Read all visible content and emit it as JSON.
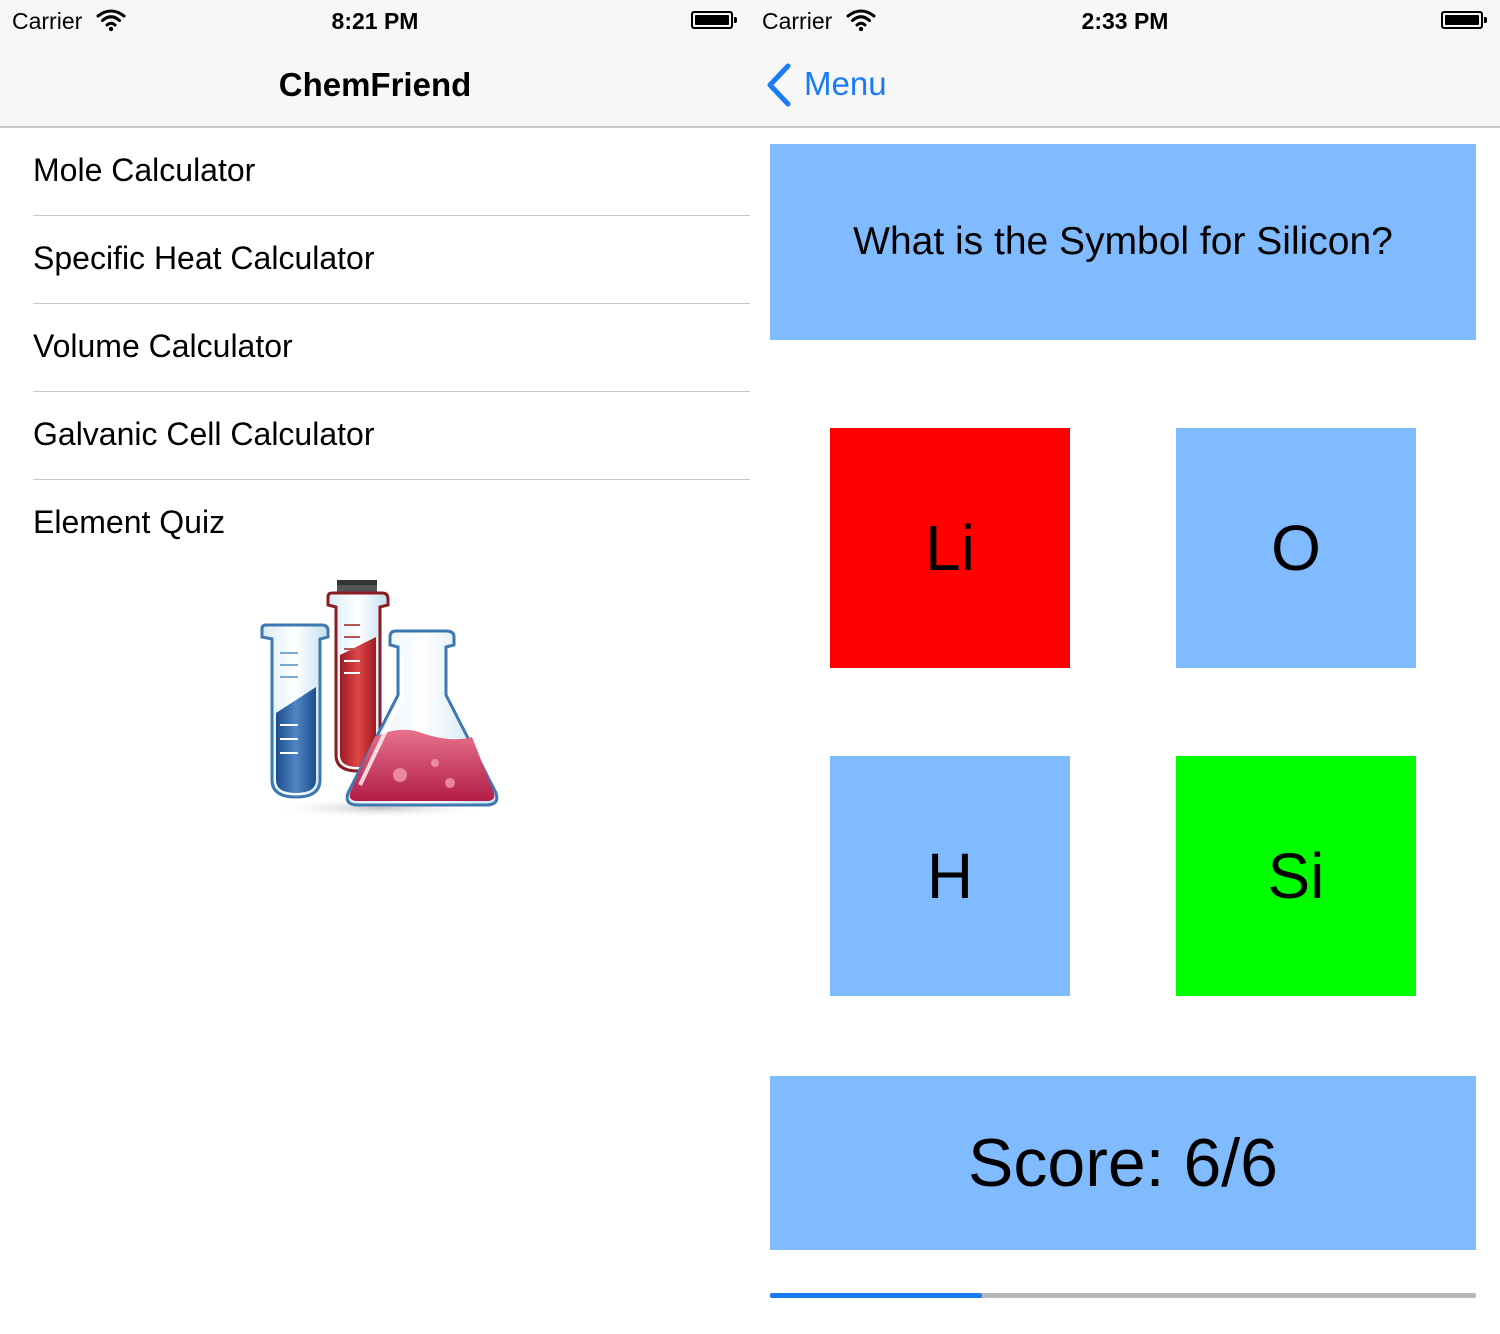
{
  "left_screen": {
    "status": {
      "carrier": "Carrier",
      "time": "8:21 PM"
    },
    "nav_title": "ChemFriend",
    "menu_items": [
      {
        "label": "Mole Calculator"
      },
      {
        "label": "Specific Heat Calculator"
      },
      {
        "label": "Volume Calculator"
      },
      {
        "label": "Galvanic Cell Calculator"
      },
      {
        "label": "Element Quiz"
      }
    ],
    "logo_icon": "chemistry-flasks-icon"
  },
  "right_screen": {
    "status": {
      "carrier": "Carrier",
      "time": "2:33 PM"
    },
    "back_label": "Menu",
    "question": "What is the Symbol for Silicon?",
    "answers": [
      {
        "label": "Li",
        "color": "#ff0000"
      },
      {
        "label": "O",
        "color": "#80baff"
      },
      {
        "label": "H",
        "color": "#80baff"
      },
      {
        "label": "Si",
        "color": "#00ff00"
      }
    ],
    "score": "Score: 6/6",
    "progress": 0.3
  },
  "colors": {
    "accent": "#1a7cf4",
    "panel": "#80baff",
    "wrong": "#ff0000",
    "correct": "#00ff00"
  }
}
